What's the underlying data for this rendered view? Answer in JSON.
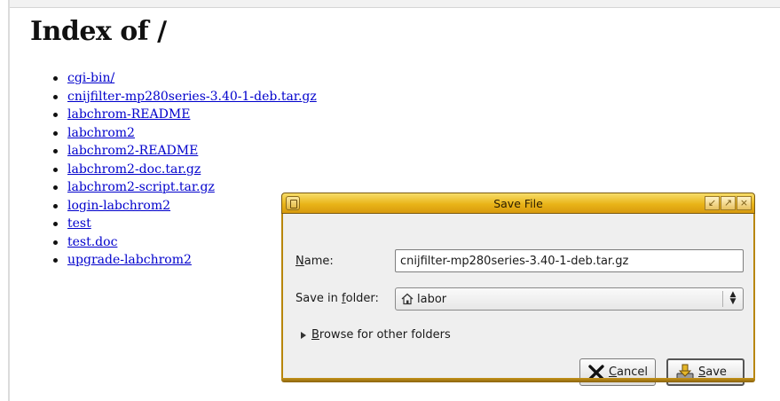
{
  "page": {
    "title": "Index of /",
    "files": [
      "cgi-bin/",
      "cnijfilter-mp280series-3.40-1-deb.tar.gz",
      "labchrom-README",
      "labchrom2",
      "labchrom2-README",
      "labchrom2-doc.tar.gz",
      "labchrom2-script.tar.gz",
      "login-labchrom2",
      "test",
      "test.doc",
      "upgrade-labchrom2"
    ]
  },
  "dialog": {
    "title": "Save File",
    "name_label_prefix": "",
    "name_label_mnemonic": "N",
    "name_label_rest": "ame:",
    "name_value": "cnijfilter-mp280series-3.40-1-deb.tar.gz",
    "folder_label_prefix": "Save in ",
    "folder_label_mnemonic": "f",
    "folder_label_rest": "older:",
    "folder_value": "labor",
    "browse_mnemonic": "B",
    "browse_rest": "rowse for other folders",
    "cancel_mnemonic": "C",
    "cancel_rest": "ancel",
    "save_mnemonic": "S",
    "save_rest": "ave",
    "icons": {
      "window_menu": "window-menu-icon",
      "home": "home-folder-icon",
      "cancel": "cancel-x-icon",
      "save": "save-download-icon"
    }
  }
}
